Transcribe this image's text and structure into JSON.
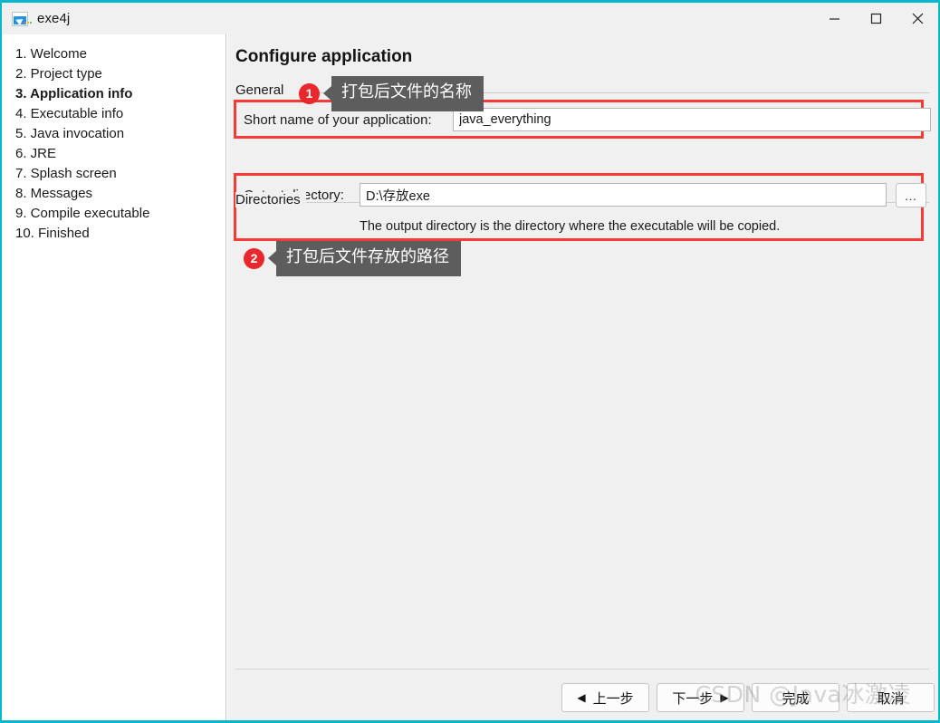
{
  "window": {
    "title": "exe4j",
    "accent_color": "#08b7ca",
    "icon": "exe4j-app-icon",
    "controls": {
      "minimize": "minimize-icon",
      "maximize": "maximize-icon",
      "close": "close-icon"
    }
  },
  "sidebar": {
    "watermark": "exe4j",
    "items": [
      {
        "label": "1. Welcome",
        "active": false
      },
      {
        "label": "2. Project type",
        "active": false
      },
      {
        "label": "3. Application info",
        "active": true
      },
      {
        "label": "4. Executable info",
        "active": false
      },
      {
        "label": "5. Java invocation",
        "active": false
      },
      {
        "label": "6. JRE",
        "active": false
      },
      {
        "label": "7. Splash screen",
        "active": false
      },
      {
        "label": "8. Messages",
        "active": false
      },
      {
        "label": "9. Compile executable",
        "active": false
      },
      {
        "label": "10. Finished",
        "active": false
      }
    ]
  },
  "main": {
    "page_title": "Configure application",
    "tab": "General",
    "short_name": {
      "label": "Short name of your application:",
      "value": "java_everything",
      "placeholder": ""
    },
    "directories": {
      "group_title": "Directories",
      "output_label": "Output directory:",
      "output_value": "D:\\存放exe",
      "output_placeholder": "",
      "browse_label": "…",
      "hint": "The output directory is the directory where the executable will be copied."
    }
  },
  "annotations": {
    "highlight_color": "#f43b36",
    "badge_color": "#e8282c",
    "callout_bg": "#5d5d5d",
    "items": [
      {
        "number": "1",
        "text": "打包后文件的名称"
      },
      {
        "number": "2",
        "text": "打包后文件存放的路径"
      }
    ]
  },
  "footer": {
    "buttons": [
      {
        "label": "上一步",
        "arrow": "◀",
        "arrow_side": "left",
        "disabled": false
      },
      {
        "label": "下一步",
        "arrow": "▶",
        "arrow_side": "right",
        "disabled": false
      },
      {
        "label": "完成",
        "arrow": "",
        "arrow_side": "none",
        "disabled": true
      },
      {
        "label": "取消",
        "arrow": "",
        "arrow_side": "none",
        "disabled": false
      }
    ]
  },
  "watermark": {
    "text": "CSDN @Java冰激凌"
  }
}
